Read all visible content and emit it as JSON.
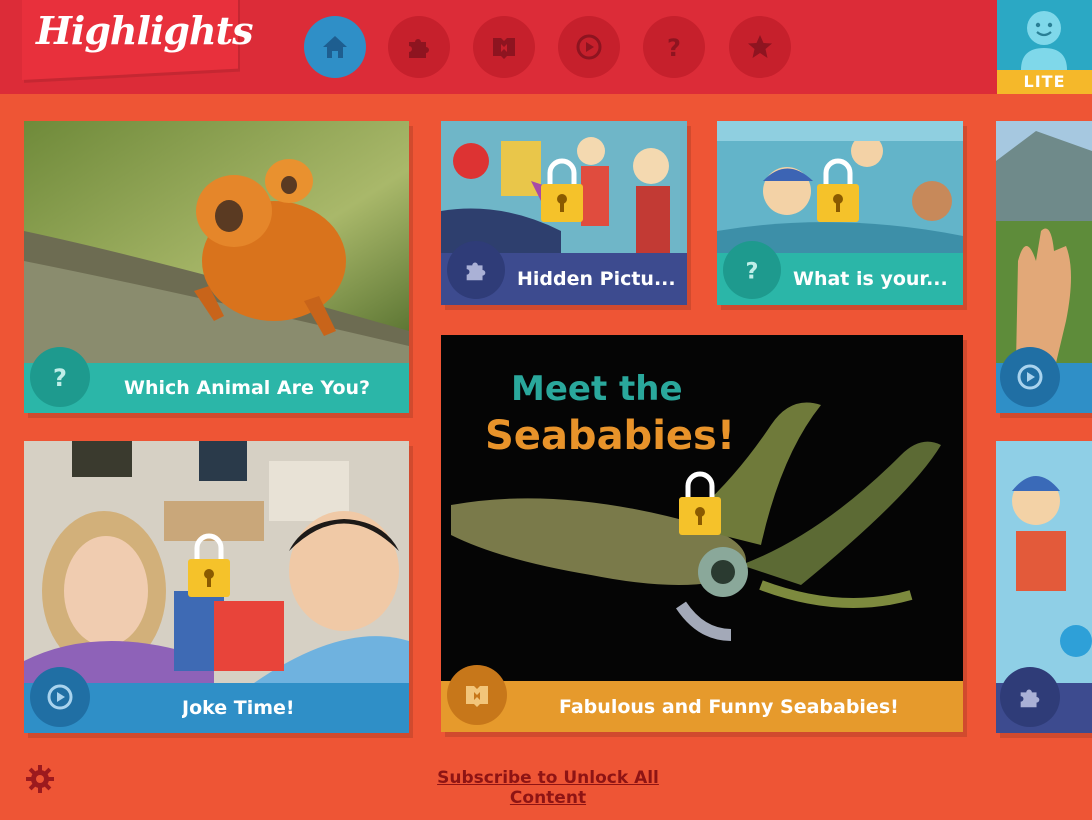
{
  "brand": {
    "logo_text": "Highlights"
  },
  "nav": {
    "items": [
      {
        "icon": "home-icon"
      },
      {
        "icon": "puzzle-icon"
      },
      {
        "icon": "book-icon"
      },
      {
        "icon": "play-icon"
      },
      {
        "icon": "question-icon"
      },
      {
        "icon": "star-icon"
      }
    ],
    "active_index": 0
  },
  "account": {
    "badge": "LITE",
    "icon": "smiley-user-icon"
  },
  "tiles": [
    {
      "caption": "Which Animal Are You?",
      "type_icon": "question-icon",
      "locked": false,
      "caption_color": "#2bb6a8"
    },
    {
      "caption": "Hidden Pictu...",
      "type_icon": "puzzle-icon",
      "locked": true,
      "caption_color": "#3d4b8f"
    },
    {
      "caption": "What is your...",
      "type_icon": "question-icon",
      "locked": true,
      "caption_color": "#2bb6a8"
    },
    {
      "caption": "Joke Time!",
      "type_icon": "play-icon",
      "locked": true,
      "caption_color": "#2f8fc7"
    },
    {
      "caption": "Fabulous and Funny Seababies!",
      "type_icon": "book-icon",
      "locked": true,
      "caption_color": "#e69a2c"
    }
  ],
  "seababies_art": {
    "line1": "Meet the",
    "line2": "Seababies!"
  },
  "footer": {
    "subscribe_label": "Subscribe to Unlock All Content",
    "settings_icon": "gear-icon"
  },
  "colors": {
    "background": "#ee5535",
    "topbar": "#dc2c38",
    "nav_active": "#2f8fc7",
    "lock": "#f5c22a"
  }
}
